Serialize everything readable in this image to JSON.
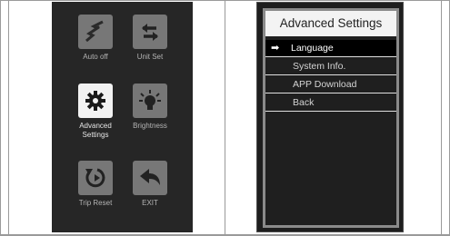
{
  "main_menu": {
    "tiles": [
      {
        "label": "Auto off",
        "icon": "auto-off-icon"
      },
      {
        "label": "Unit Set",
        "icon": "unit-set-icon"
      },
      {
        "label": "Advanced\nSettings",
        "icon": "gear-icon",
        "selected": true
      },
      {
        "label": "Brightness",
        "icon": "brightness-icon"
      },
      {
        "label": "Trip Reset",
        "icon": "trip-reset-icon"
      },
      {
        "label": "EXIT",
        "icon": "back-arrow-icon"
      }
    ]
  },
  "advanced_settings": {
    "title": "Advanced Settings",
    "items": [
      {
        "label": "Language",
        "selected": true
      },
      {
        "label": "System Info."
      },
      {
        "label": "APP Download"
      },
      {
        "label": "Back"
      }
    ]
  },
  "colors": {
    "screen_background": "#262626",
    "tile_icon_background": "#777777",
    "selected_tile_background": "#f2f2f2",
    "panel_border": "#8a8a8a",
    "title_background": "#f3f3f3"
  }
}
